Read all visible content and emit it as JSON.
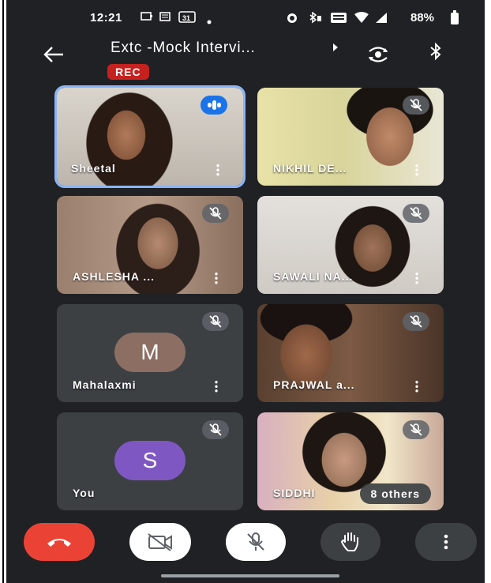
{
  "status_bar": {
    "time": "12:21",
    "battery": "88%",
    "calendar_day": "31"
  },
  "header": {
    "title": "Extc -Mock Intervi...",
    "rec_label": "REC"
  },
  "participants": [
    {
      "name": "Sheetal",
      "speaking": true
    },
    {
      "name": "NIKHIL DE...",
      "muted": true
    },
    {
      "name": "ASHLESHA ...",
      "muted": true
    },
    {
      "name": "SAWALI NA...",
      "muted": true
    },
    {
      "name": "Mahalaxmi",
      "initial": "M",
      "avatar_color": "#8d6e63",
      "muted": true
    },
    {
      "name": "PRAJWAL a...",
      "muted": true
    },
    {
      "name": "You",
      "initial": "S",
      "avatar_color": "#7e57c2",
      "muted": true
    },
    {
      "name": "SIDDHI",
      "muted": true,
      "overflow_label": "8 others"
    }
  ],
  "colors": {
    "background": "#202124",
    "tile": "#3c4043",
    "end_call": "#ea4335",
    "speaking": "#1a73e8",
    "rec": "#c5221f"
  },
  "controls": [
    "end-call",
    "camera-off",
    "mic-off",
    "raise-hand",
    "more-options"
  ]
}
